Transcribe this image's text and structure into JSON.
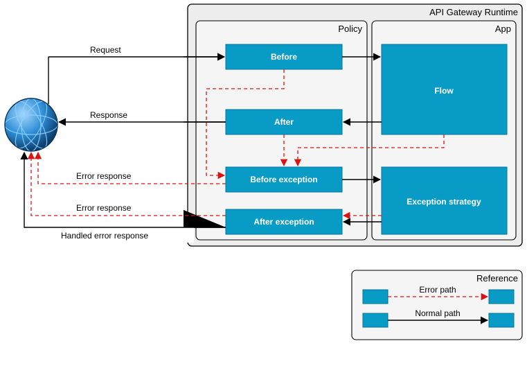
{
  "diagram": {
    "runtimeTitle": "API Gateway Runtime",
    "policyTitle": "Policy",
    "appTitle": "App",
    "before": "Before",
    "after": "After",
    "beforeException": "Before exception",
    "afterException": "After exception",
    "flow": "Flow",
    "exceptionStrategy": "Exception strategy",
    "edges": {
      "request": "Request",
      "response": "Response",
      "errorResponse1": "Error response",
      "errorResponse2": "Error response",
      "handledErrorResponse": "Handled error response"
    }
  },
  "reference": {
    "title": "Reference",
    "errorPath": "Error path",
    "normalPath": "Normal path"
  }
}
